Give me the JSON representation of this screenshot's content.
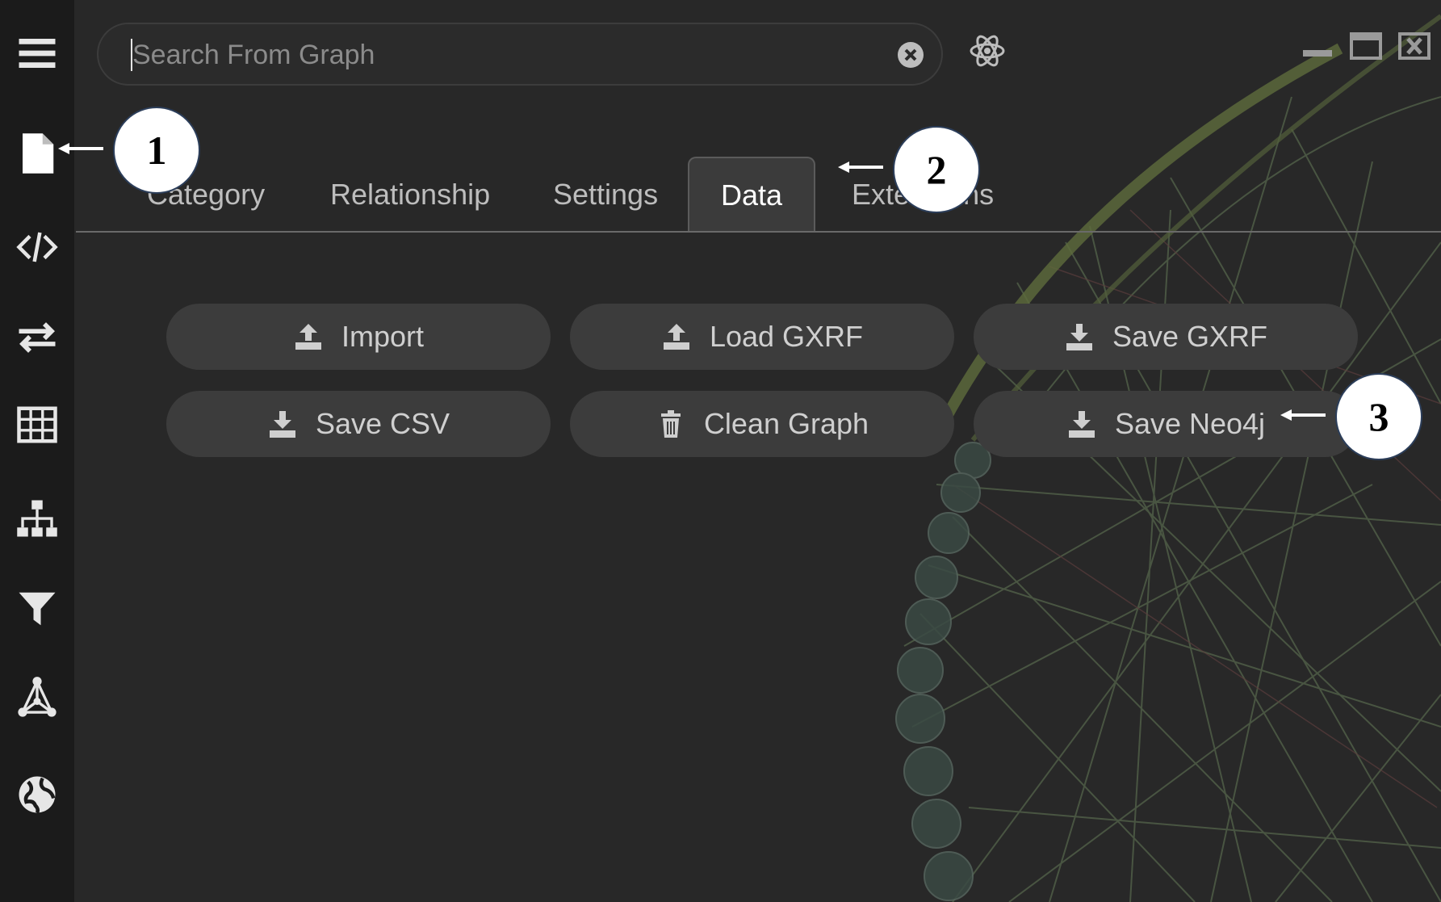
{
  "search": {
    "placeholder": "Search From Graph",
    "value": ""
  },
  "tabs": [
    {
      "label": "Category"
    },
    {
      "label": "Relationship"
    },
    {
      "label": "Settings"
    },
    {
      "label": "Data",
      "active": true
    },
    {
      "label": "Extensions"
    }
  ],
  "data_panel": {
    "buttons": [
      {
        "label": "Import",
        "icon": "upload-icon"
      },
      {
        "label": "Load GXRF",
        "icon": "upload-icon"
      },
      {
        "label": "Save GXRF",
        "icon": "download-icon"
      },
      {
        "label": "Save CSV",
        "icon": "download-icon"
      },
      {
        "label": "Clean Graph",
        "icon": "trash-icon"
      },
      {
        "label": "Save Neo4j",
        "icon": "download-icon"
      }
    ]
  },
  "sidebar": {
    "items": [
      {
        "icon": "menu-icon"
      },
      {
        "icon": "file-icon"
      },
      {
        "icon": "code-icon"
      },
      {
        "icon": "swap-arrows-icon"
      },
      {
        "icon": "table-icon"
      },
      {
        "icon": "hierarchy-icon"
      },
      {
        "icon": "filter-icon"
      },
      {
        "icon": "network-icon"
      },
      {
        "icon": "globe-icon"
      }
    ]
  },
  "callouts": {
    "one": "1",
    "two": "2",
    "three": "3"
  },
  "colors": {
    "sidebar": "#1b1b1b",
    "panel": "#282828",
    "button": "#3c3c3c",
    "active_tab": "#3b3b3b",
    "graph_edges": "#6d7f5f"
  }
}
